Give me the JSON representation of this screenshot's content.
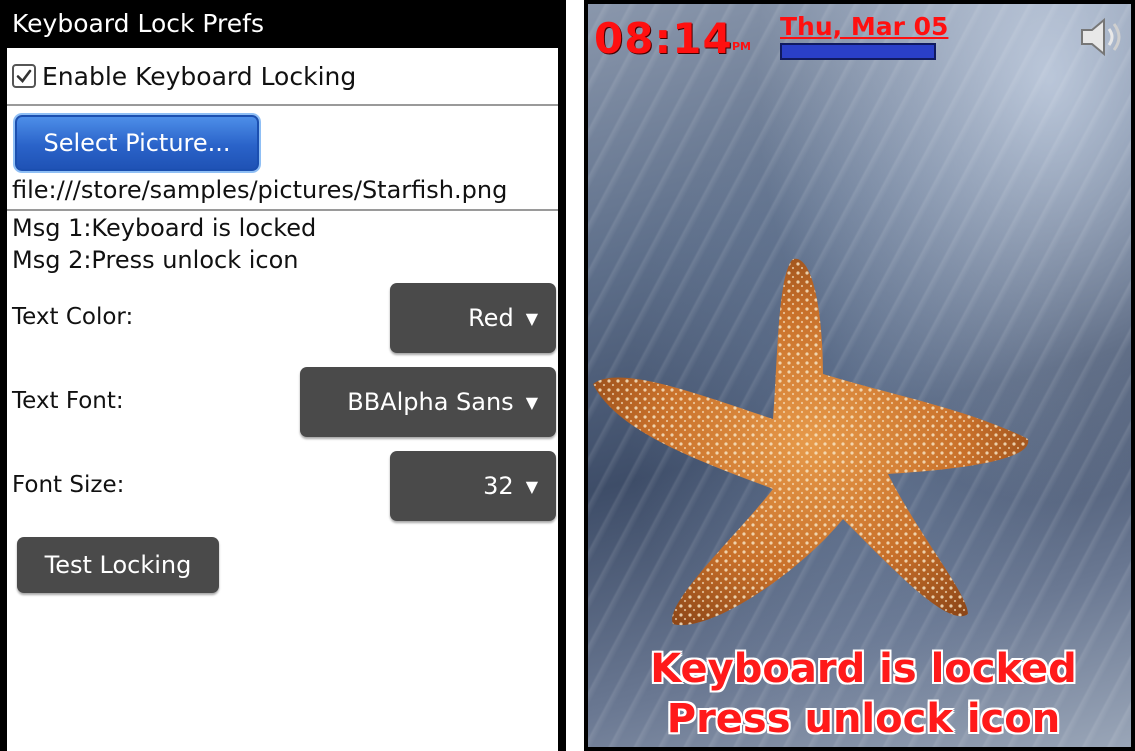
{
  "prefs": {
    "title": "Keyboard Lock Prefs",
    "enable_label": "Enable Keyboard Locking",
    "enable_checked": true,
    "select_picture_label": "Select Picture...",
    "picture_path": "file:///store/samples/pictures/Starfish.png",
    "msg1": "Msg 1:Keyboard is locked",
    "msg2": "Msg 2:Press unlock icon",
    "text_color_label": "Text Color:",
    "text_color_value": "Red",
    "text_font_label": "Text Font:",
    "text_font_value": "BBAlpha Sans",
    "font_size_label": "Font Size:",
    "font_size_value": "32",
    "test_button_label": "Test Locking",
    "dropdown_arrow": "▼"
  },
  "lockscreen": {
    "time": "08:14",
    "ampm": "PM",
    "date": "Thu, Mar 05",
    "line1": "Keyboard is locked",
    "line2": "Press unlock icon",
    "text_color": "#ff1a1a",
    "icons": [
      "speaker-icon"
    ]
  }
}
